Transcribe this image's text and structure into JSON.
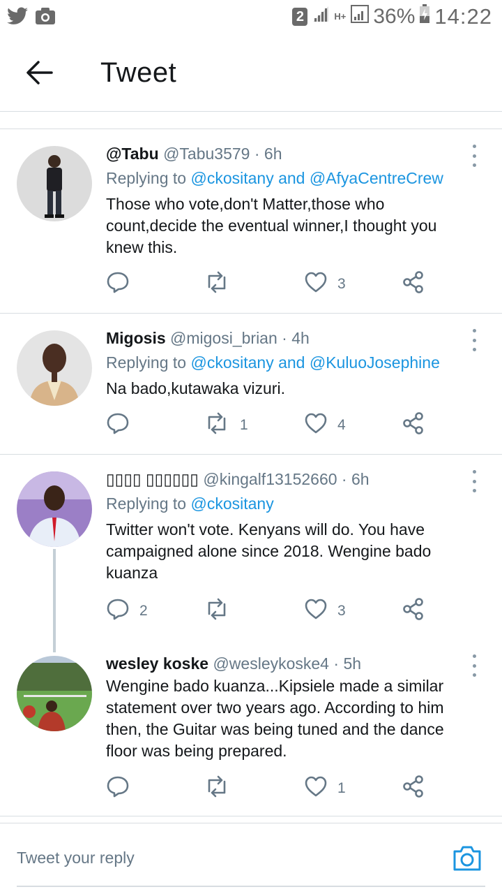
{
  "status_bar": {
    "sim": "2",
    "network": "H+",
    "battery_pct": "36%",
    "time": "14:22",
    "icons": [
      "twitter-bird-icon",
      "camera-notification-icon",
      "signal-icon",
      "battery-charging-icon"
    ]
  },
  "header": {
    "title": "Tweet",
    "back_icon": "arrow-left-icon"
  },
  "colors": {
    "link": "#1b95e0",
    "secondary_text": "#657786",
    "divider": "#d8dde1",
    "icon": "#657786"
  },
  "tweets": [
    {
      "name": "@Tabu",
      "handle": "@Tabu3579",
      "dot": "·",
      "time": "6h",
      "replying_prefix": "Replying to",
      "replying_mentions": "@ckositany and @AfyaCentreCrew",
      "text": "Those who vote,don't Matter,those who count,decide the eventual winner,I thought you knew this.",
      "replies": "",
      "retweets": "",
      "likes": "3"
    },
    {
      "name": "Migosis",
      "handle": "@migosi_brian",
      "dot": "·",
      "time": "4h",
      "replying_prefix": "Replying to",
      "replying_mentions": "@ckositany and @KuluoJosephine",
      "text": "Na bado,kutawaka vizuri.",
      "replies": "",
      "retweets": "1",
      "likes": "4"
    },
    {
      "name": "▯▯▯▯ ▯▯▯▯▯▯",
      "handle": "@kingalf13152660",
      "dot": "·",
      "time": "6h",
      "replying_prefix": "Replying to",
      "replying_mentions": "@ckositany",
      "text": "Twitter won't vote. Kenyans will do. You have campaigned alone since 2018. Wengine bado kuanza",
      "replies": "2",
      "retweets": "",
      "likes": "3"
    },
    {
      "name": "wesley koske",
      "handle": "@wesleykoske4",
      "dot": "·",
      "time": "5h",
      "text": "Wengine bado kuanza...Kipsiele made a similar statement over two years ago. According to him then, the Guitar was being tuned and the dance floor was being prepared.",
      "replies": "",
      "retweets": "",
      "likes": "1"
    }
  ],
  "reply_bar": {
    "placeholder": "Tweet your reply",
    "camera_icon": "camera-icon"
  }
}
